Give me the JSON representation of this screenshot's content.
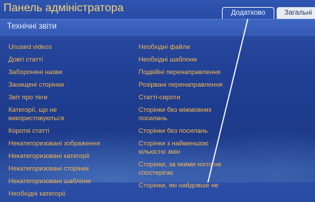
{
  "header": {
    "title": "Панель адміністратора"
  },
  "tabs": [
    {
      "label": "Додатково",
      "active": true
    },
    {
      "label": "Загальні",
      "active": false
    }
  ],
  "section": {
    "title": "Технічні звіти"
  },
  "links_left": [
    "Unused videos",
    "Довгі статті",
    "Заборонені назви",
    "Захищені сторінки",
    "Звіт про теги",
    "Категорії, що не використовуються",
    "Короткі статті",
    "Некатегоризовані зображення",
    "Некатегоризовані категорії",
    "Некатегоризовані сторінки",
    "Некатегоризовані шаблони",
    "Необхідні категорії"
  ],
  "links_right": [
    "Необхідні файли",
    "Необхідні шаблони",
    "Подвійні перенаправлення",
    "Розірвані перенаправлення",
    "Статті-сироти",
    "Сторінки без міжмовних посилань",
    "Сторінки без посилань",
    "Сторінки з найменшою кількістю змін",
    "Сторінки, за якими ніхто не спостерігає",
    "Сторінки, які найдовше не"
  ],
  "colors": {
    "title": "#f7d27a",
    "link": "#f4b64f",
    "background": "#203f93",
    "section_bar": "#3a60bd"
  }
}
